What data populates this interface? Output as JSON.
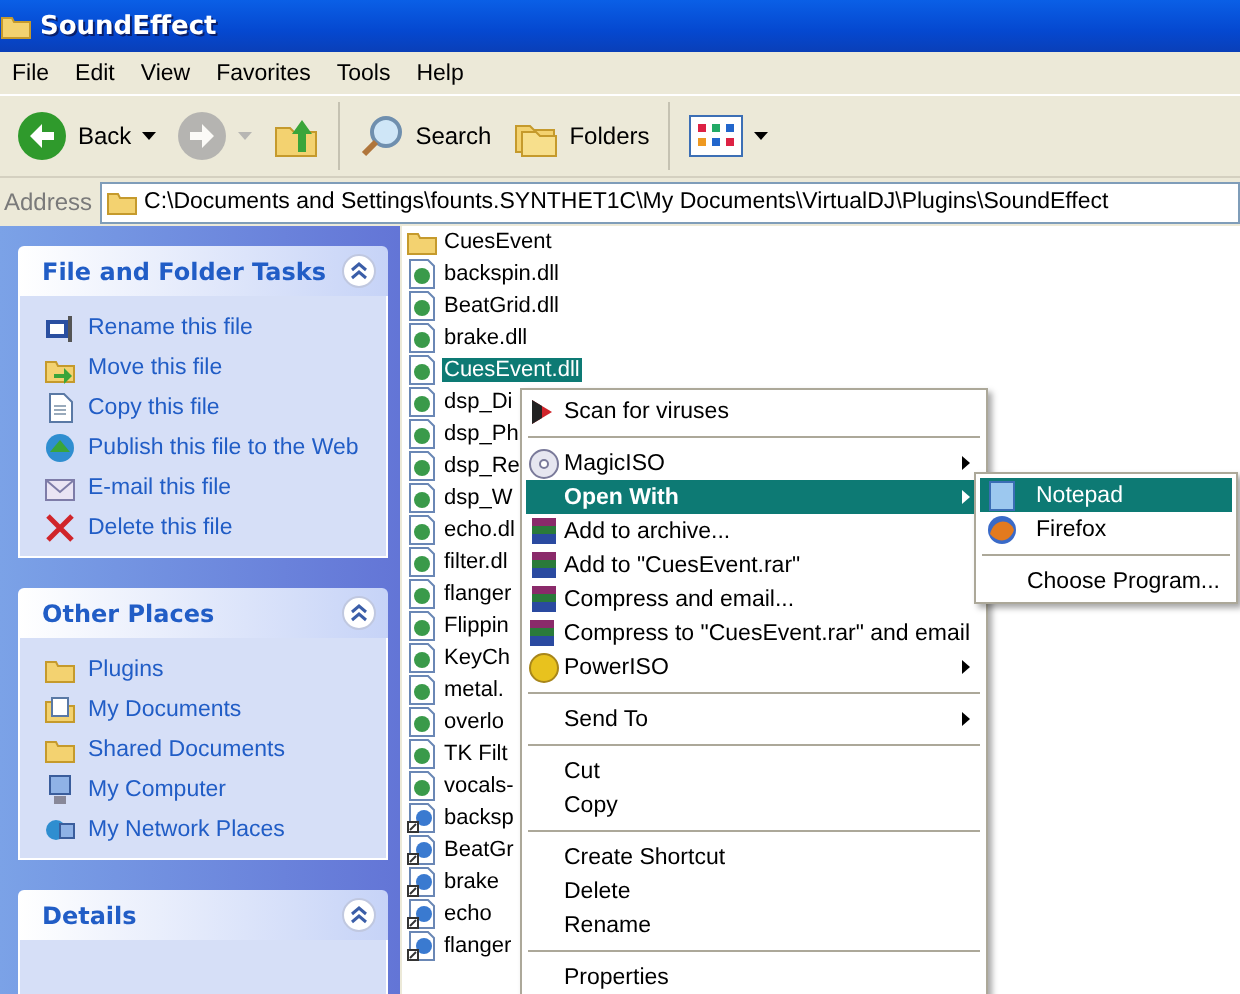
{
  "window": {
    "title": "SoundEffect"
  },
  "menu_bar": [
    "File",
    "Edit",
    "View",
    "Favorites",
    "Tools",
    "Help"
  ],
  "toolbar": [
    {
      "kind": "back",
      "label": "Back",
      "disabled": false
    },
    {
      "kind": "forward",
      "disabled": true
    },
    {
      "kind": "up",
      "disabled": false
    },
    {
      "kind": "search",
      "label": "Search",
      "disabled": false
    },
    {
      "kind": "folders",
      "label": "Folders",
      "disabled": false
    },
    {
      "kind": "views",
      "disabled": false
    }
  ],
  "address": {
    "label": "Address",
    "value": "C:\\Documents and Settings\\founts.SYNTHET1C\\My Documents\\VirtualDJ\\Plugins\\SoundEffect"
  },
  "sidebar": [
    {
      "title": "File and Folder Tasks",
      "expanded": true,
      "items": [
        {
          "kind": "rename",
          "label": "Rename this file"
        },
        {
          "kind": "move",
          "label": "Move this file"
        },
        {
          "kind": "copy",
          "label": "Copy this file"
        },
        {
          "kind": "publish",
          "label": "Publish this file to the Web"
        },
        {
          "kind": "email",
          "label": "E-mail this file"
        },
        {
          "kind": "delete",
          "label": "Delete this file"
        }
      ]
    },
    {
      "title": "Other Places",
      "expanded": true,
      "items": [
        {
          "kind": "folder",
          "label": "Plugins"
        },
        {
          "kind": "documents",
          "label": "My Documents"
        },
        {
          "kind": "folder",
          "label": "Shared Documents"
        },
        {
          "kind": "computer",
          "label": "My Computer"
        },
        {
          "kind": "network",
          "label": "My Network Places"
        }
      ]
    },
    {
      "title": "Details",
      "expanded": true
    }
  ],
  "files": [
    {
      "kind": "folder",
      "name": "CuesEvent",
      "selected": false
    },
    {
      "kind": "dll",
      "name": "backspin.dll",
      "selected": false
    },
    {
      "kind": "dll",
      "name": "BeatGrid.dll",
      "selected": false
    },
    {
      "kind": "dll",
      "name": "brake.dll",
      "selected": false
    },
    {
      "kind": "dll",
      "name": "CuesEvent.dll",
      "selected": true
    },
    {
      "kind": "dll",
      "name": "dsp_Di",
      "selected": false
    },
    {
      "kind": "dll",
      "name": "dsp_Ph",
      "selected": false
    },
    {
      "kind": "dll",
      "name": "dsp_Re",
      "selected": false
    },
    {
      "kind": "dll",
      "name": "dsp_W",
      "selected": false
    },
    {
      "kind": "dll",
      "name": "echo.dl",
      "selected": false
    },
    {
      "kind": "dll",
      "name": "filter.dl",
      "selected": false
    },
    {
      "kind": "dll",
      "name": "flanger",
      "selected": false
    },
    {
      "kind": "dll",
      "name": "Flippin",
      "selected": false
    },
    {
      "kind": "dll",
      "name": "KeyCh",
      "selected": false
    },
    {
      "kind": "dll",
      "name": "metal.",
      "selected": false
    },
    {
      "kind": "dll",
      "name": "overlo",
      "selected": false
    },
    {
      "kind": "dll",
      "name": "TK Filt",
      "selected": false
    },
    {
      "kind": "dll",
      "name": "vocals-",
      "selected": false
    },
    {
      "kind": "shortcut",
      "name": "backsp",
      "selected": false
    },
    {
      "kind": "shortcut",
      "name": "BeatGr",
      "selected": false
    },
    {
      "kind": "shortcut",
      "name": "brake",
      "selected": false
    },
    {
      "kind": "shortcut",
      "name": "echo",
      "selected": false
    },
    {
      "kind": "shortcut",
      "name": "flanger",
      "selected": false
    }
  ],
  "context_menu": [
    {
      "kind": "antivirus",
      "label": "Scan for viruses",
      "bold": false,
      "selected": false,
      "submenu": false
    },
    {
      "kind": "separator"
    },
    {
      "kind": "disc",
      "label": "MagicISO",
      "bold": false,
      "selected": false,
      "submenu": true
    },
    {
      "kind": "text",
      "label": "Open With",
      "bold": true,
      "selected": true,
      "submenu": true
    },
    {
      "kind": "archive",
      "label": "Add to archive...",
      "bold": false,
      "selected": false,
      "submenu": false
    },
    {
      "kind": "archive",
      "label": "Add to \"CuesEvent.rar\"",
      "bold": false,
      "selected": false,
      "submenu": false
    },
    {
      "kind": "archive",
      "label": "Compress and email...",
      "bold": false,
      "selected": false,
      "submenu": false
    },
    {
      "kind": "archive",
      "label": "Compress to \"CuesEvent.rar\" and email",
      "bold": false,
      "selected": false,
      "submenu": false
    },
    {
      "kind": "coin",
      "label": "PowerISO",
      "bold": false,
      "selected": false,
      "submenu": true
    },
    {
      "kind": "separator"
    },
    {
      "kind": "text",
      "label": "Send To",
      "bold": false,
      "selected": false,
      "submenu": true
    },
    {
      "kind": "separator"
    },
    {
      "kind": "text",
      "label": "Cut",
      "bold": false,
      "selected": false,
      "submenu": false
    },
    {
      "kind": "text",
      "label": "Copy",
      "bold": false,
      "selected": false,
      "submenu": false
    },
    {
      "kind": "separator"
    },
    {
      "kind": "text",
      "label": "Create Shortcut",
      "bold": false,
      "selected": false,
      "submenu": false
    },
    {
      "kind": "text",
      "label": "Delete",
      "bold": false,
      "selected": false,
      "submenu": false
    },
    {
      "kind": "text",
      "label": "Rename",
      "bold": false,
      "selected": false,
      "submenu": false
    },
    {
      "kind": "separator"
    },
    {
      "kind": "text",
      "label": "Properties",
      "bold": false,
      "selected": false,
      "submenu": false
    }
  ],
  "submenu": [
    {
      "kind": "notepad",
      "label": "Notepad",
      "selected": true
    },
    {
      "kind": "browser",
      "label": "Firefox",
      "selected": false
    },
    {
      "kind": "separator"
    },
    {
      "kind": "text",
      "label": "Choose Program...",
      "selected": false
    }
  ]
}
